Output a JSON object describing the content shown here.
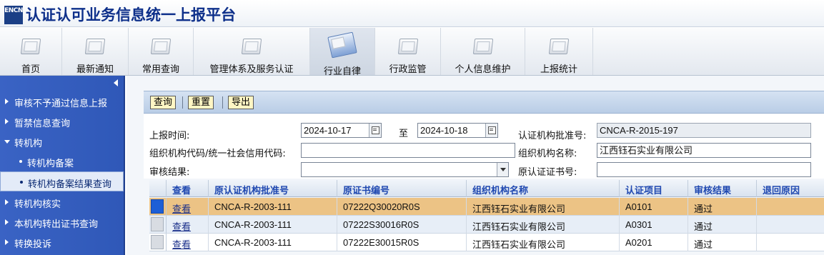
{
  "app": {
    "logo_text": "ENCN",
    "title": "认证认可业务信息统一上报平台"
  },
  "topnav": [
    {
      "label": "首页",
      "icon": "folder-icon",
      "active": false
    },
    {
      "label": "最新通知",
      "icon": "folder-icon",
      "active": false
    },
    {
      "label": "常用查询",
      "icon": "folder-icon",
      "active": false
    },
    {
      "label": "管理体系及服务认证",
      "icon": "folder-icon",
      "active": false
    },
    {
      "label": "行业自律",
      "icon": "documents-icon",
      "active": true
    },
    {
      "label": "行政监管",
      "icon": "folder-icon",
      "active": false
    },
    {
      "label": "个人信息维护",
      "icon": "folder-icon",
      "active": false
    },
    {
      "label": "上报统计",
      "icon": "folder-icon",
      "active": false
    }
  ],
  "sidebar": {
    "items": [
      {
        "label": "审核不予通过信息上报",
        "type": "group",
        "expanded": false
      },
      {
        "label": "暂禁信息查询",
        "type": "group",
        "expanded": false
      },
      {
        "label": "转机构",
        "type": "group",
        "expanded": true
      },
      {
        "label": "转机构备案",
        "type": "sub",
        "selected": false
      },
      {
        "label": "转机构备案结果查询",
        "type": "sub",
        "selected": true
      },
      {
        "label": "转机构核实",
        "type": "group",
        "expanded": false
      },
      {
        "label": "本机构转出证书查询",
        "type": "group",
        "expanded": false
      },
      {
        "label": "转换投诉",
        "type": "group",
        "expanded": false
      }
    ]
  },
  "toolbar": {
    "query_label": "查询",
    "reset_label": "重置",
    "export_label": "导出"
  },
  "form": {
    "report_time_label": "上报时间:",
    "date_from": "2024-10-17",
    "to_label": "至",
    "date_to": "2024-10-18",
    "cert_body_no_label": "认证机构批准号:",
    "cert_body_no_value": "CNCA-R-2015-197",
    "org_code_label": "组织机构代码/统一社会信用代码:",
    "org_code_value": "",
    "org_name_label": "组织机构名称:",
    "org_name_value": "江西钰石实业有限公司",
    "audit_result_label": "审核结果:",
    "audit_result_value": "",
    "orig_cert_no_label": "原认证证书号:",
    "orig_cert_no_value": ""
  },
  "grid": {
    "columns": [
      "查看",
      "原认证机构批准号",
      "原证书编号",
      "组织机构名称",
      "认证项目",
      "审核结果",
      "退回原因"
    ],
    "rows": [
      {
        "view": "查看",
        "orig_body_no": "CNCA-R-2003-111",
        "orig_cert_no": "07222Q30020R0S",
        "org_name": "江西钰石实业有限公司",
        "project": "A0101",
        "result": "通过",
        "return_reason": "",
        "selected": true
      },
      {
        "view": "查看",
        "orig_body_no": "CNCA-R-2003-111",
        "orig_cert_no": "07222S30016R0S",
        "org_name": "江西钰石实业有限公司",
        "project": "A0301",
        "result": "通过",
        "return_reason": "",
        "selected": false
      },
      {
        "view": "查看",
        "orig_body_no": "CNCA-R-2003-111",
        "orig_cert_no": "07222E30015R0S",
        "org_name": "江西钰石实业有限公司",
        "project": "A0201",
        "result": "通过",
        "return_reason": "",
        "selected": false
      }
    ]
  },
  "colors": {
    "brand": "#0d2f8a",
    "sidebar": "#3a63c4",
    "selected_row": "#ecc385",
    "link": "#1a2f8a"
  }
}
